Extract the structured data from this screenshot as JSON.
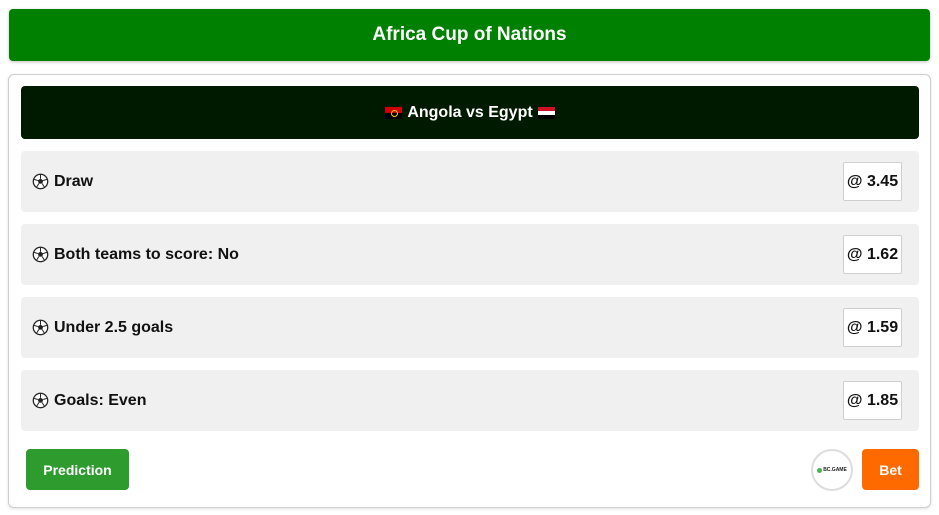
{
  "header": {
    "title": "Africa Cup of Nations"
  },
  "match": {
    "title": "Angola vs Egypt",
    "home_flag": "angola-flag-icon",
    "away_flag": "egypt-flag-icon"
  },
  "tips": [
    {
      "icon": "soccer-ball-icon",
      "label": "Draw",
      "odds": "@ 3.45"
    },
    {
      "icon": "soccer-ball-icon",
      "label": "Both teams to score: No",
      "odds": "@ 1.62"
    },
    {
      "icon": "soccer-ball-icon",
      "label": "Under 2.5 goals",
      "odds": "@ 1.59"
    },
    {
      "icon": "soccer-ball-icon",
      "label": "Goals: Even",
      "odds": "@ 1.85"
    }
  ],
  "actions": {
    "prediction_label": "Prediction",
    "bet_label": "Bet",
    "sponsor_logo_text": "BC.GAME"
  },
  "colors": {
    "header_bg": "#008000",
    "match_bar_bg": "#001a00",
    "prediction_button": "#2e9b2e",
    "bet_button": "#ff6a00"
  }
}
